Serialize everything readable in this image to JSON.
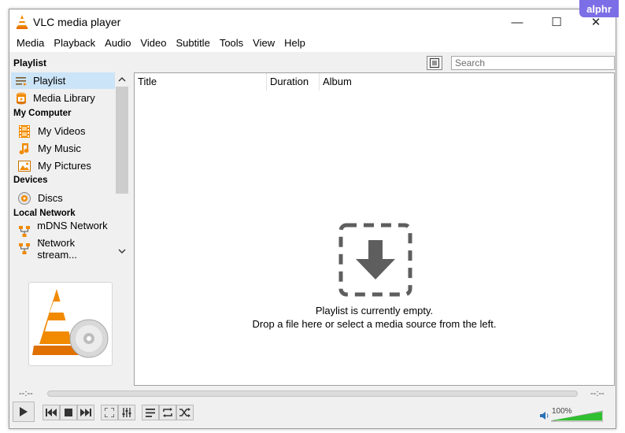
{
  "window": {
    "title": "VLC media player",
    "badge": "alphr"
  },
  "titlebar_buttons": {
    "minimize": "—",
    "maximize": "☐",
    "close": "✕"
  },
  "menu": [
    "Media",
    "Playback",
    "Audio",
    "Video",
    "Subtitle",
    "Tools",
    "View",
    "Help"
  ],
  "panel": {
    "label": "Playlist",
    "search_placeholder": "Search"
  },
  "sidebar": {
    "items": [
      {
        "label": "Playlist",
        "icon": "playlist-icon",
        "selected": true
      },
      {
        "label": "Media Library",
        "icon": "media-library-icon"
      }
    ],
    "categories": [
      {
        "label": "My Computer",
        "items": [
          {
            "label": "My Videos",
            "icon": "film-icon"
          },
          {
            "label": "My Music",
            "icon": "music-note-icon"
          },
          {
            "label": "My Pictures",
            "icon": "picture-icon"
          }
        ]
      },
      {
        "label": "Devices",
        "items": [
          {
            "label": "Discs",
            "icon": "disc-icon"
          }
        ]
      },
      {
        "label": "Local Network",
        "items": [
          {
            "label": "mDNS Network ...",
            "icon": "network-icon"
          },
          {
            "label": "Network stream...",
            "icon": "network-icon"
          }
        ]
      }
    ]
  },
  "playlist": {
    "columns": [
      "Title",
      "Duration",
      "Album"
    ],
    "empty_line1": "Playlist is currently empty.",
    "empty_line2": "Drop a file here or select a media source from the left."
  },
  "seek": {
    "elapsed": "--:--",
    "remaining": "--:--",
    "progress": 0
  },
  "volume": {
    "percent_label": "100%",
    "level": 1.0
  },
  "colors": {
    "accent": "#ff8800",
    "selection": "#cce4f7",
    "volume_green": "#2fbf2f",
    "badge": "#7c6ee6"
  }
}
